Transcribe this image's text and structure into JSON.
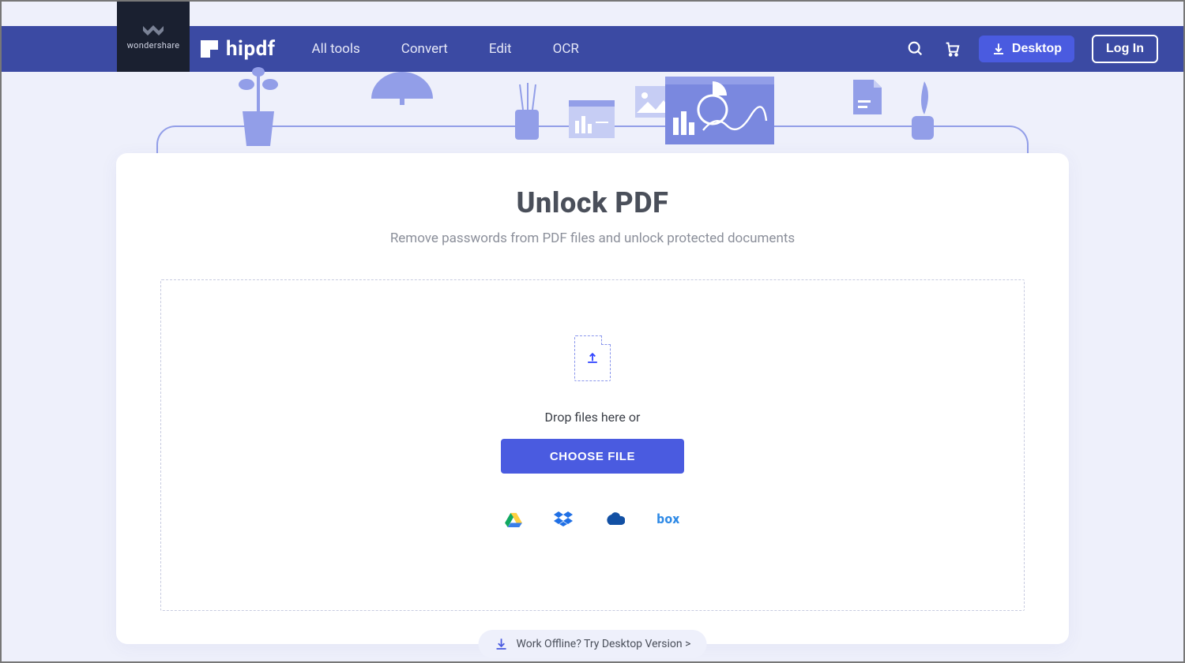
{
  "brand": {
    "wondershare": "wondershare",
    "hipdf": "hipdf"
  },
  "nav": {
    "items": [
      "All tools",
      "Convert",
      "Edit",
      "OCR"
    ],
    "desktop": "Desktop",
    "login": "Log In"
  },
  "page": {
    "title": "Unlock PDF",
    "subtitle": "Remove passwords from PDF files and unlock protected documents",
    "drop_text": "Drop files here or",
    "choose_btn": "CHOOSE FILE",
    "offline_pill": "Work Offline? Try Desktop Version >"
  },
  "storage": {
    "box_label": "box"
  }
}
